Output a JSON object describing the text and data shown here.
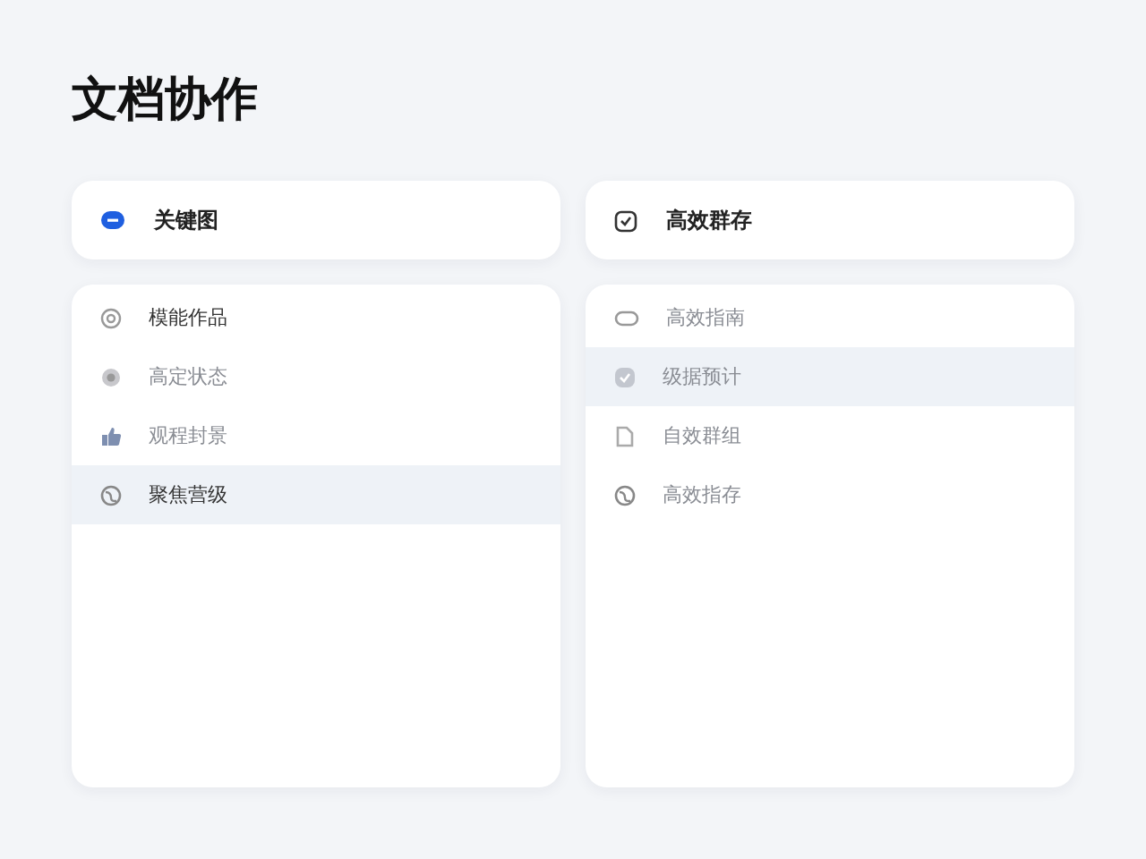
{
  "title": "文档协作",
  "columns": [
    {
      "header": {
        "label": "关键图"
      },
      "items": [
        {
          "label": "模能作品",
          "selected": false,
          "muted": false
        },
        {
          "label": "高定状态",
          "selected": false,
          "muted": true
        },
        {
          "label": "观程封景",
          "selected": false,
          "muted": true
        },
        {
          "label": "聚焦营级",
          "selected": true,
          "muted": false
        }
      ]
    },
    {
      "header": {
        "label": "高效群存"
      },
      "items": [
        {
          "label": "高效指南",
          "selected": false,
          "muted": true
        },
        {
          "label": "级据预计",
          "selected": true,
          "muted": true
        },
        {
          "label": "自效群组",
          "selected": false,
          "muted": true
        },
        {
          "label": "高效指存",
          "selected": false,
          "muted": true
        }
      ]
    }
  ]
}
